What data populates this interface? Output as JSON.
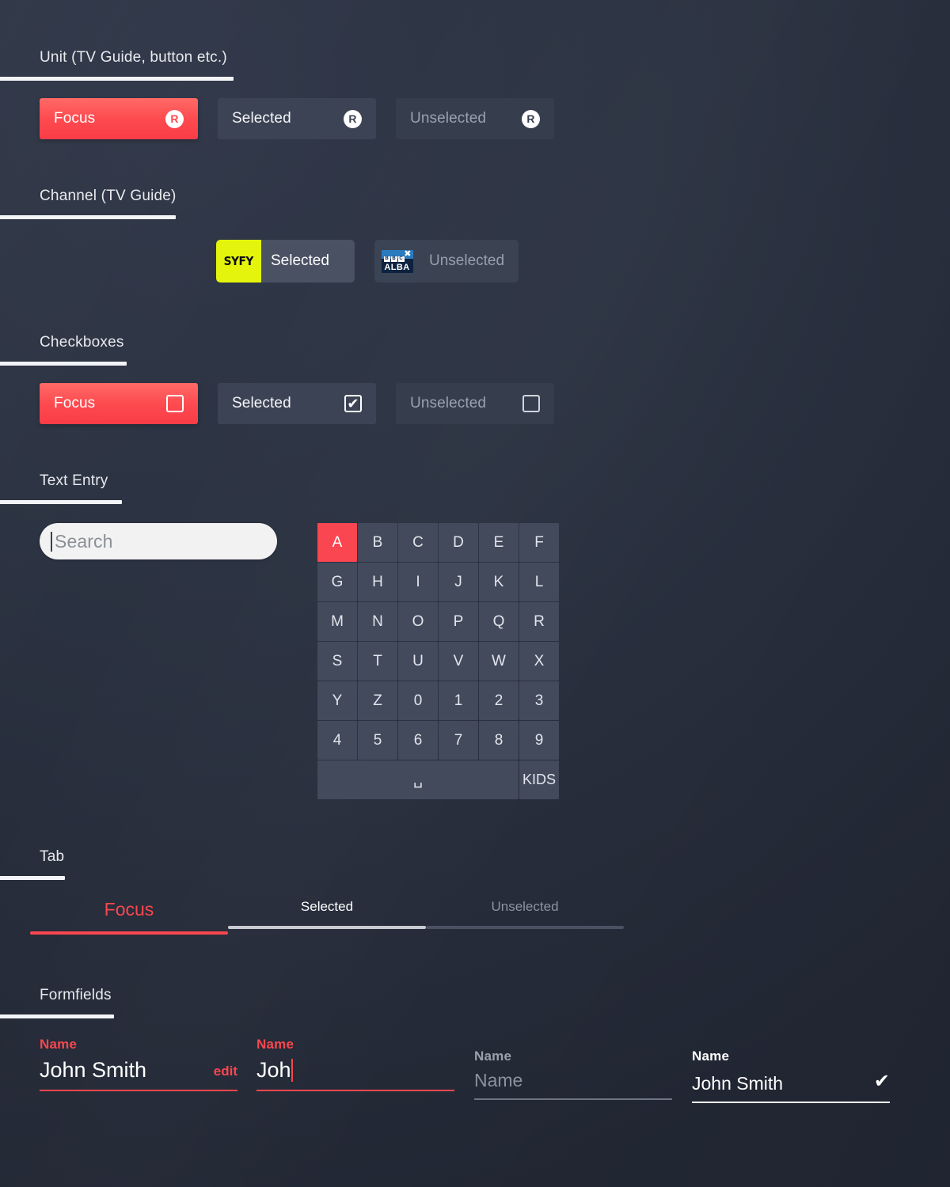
{
  "sections": [
    {
      "title": "Unit (TV Guide, button etc.)",
      "rule_width": 295
    },
    {
      "title": "Channel (TV Guide)",
      "rule_width": 222
    },
    {
      "title": "Checkboxes",
      "rule_width": 160
    },
    {
      "title": "Text Entry",
      "rule_width": 154
    },
    {
      "title": "Tab",
      "rule_width": 82
    },
    {
      "title": "Formfields",
      "rule_width": 144
    }
  ],
  "unit": {
    "items": [
      {
        "label": "Focus",
        "state": "focus",
        "icon": "remote-control-icon",
        "icon_glyph": "R"
      },
      {
        "label": "Selected",
        "state": "selected",
        "icon": "remote-control-icon",
        "icon_glyph": "R"
      },
      {
        "label": "Unselected",
        "state": "unselected",
        "icon": "remote-control-icon",
        "icon_glyph": "R"
      }
    ]
  },
  "channel": {
    "items": [
      {
        "label": "Selected",
        "state": "selected",
        "logo": "syfy-logo",
        "logo_text": "SYFY"
      },
      {
        "label": "Unselected",
        "state": "unselected",
        "logo": "bbc-alba-logo",
        "logo_text": "ALBA",
        "logo_sub": "BBC"
      }
    ]
  },
  "checkboxes": {
    "items": [
      {
        "label": "Focus",
        "state": "focus",
        "checked": false
      },
      {
        "label": "Selected",
        "state": "selected",
        "checked": true
      },
      {
        "label": "Unselected",
        "state": "unselected",
        "checked": false
      }
    ],
    "tick_glyph": "✔"
  },
  "text_entry": {
    "search_placeholder": "Search",
    "keyboard_keys": [
      "A",
      "B",
      "C",
      "D",
      "E",
      "F",
      "G",
      "H",
      "I",
      "J",
      "K",
      "L",
      "M",
      "N",
      "O",
      "P",
      "Q",
      "R",
      "S",
      "T",
      "U",
      "V",
      "W",
      "X",
      "Y",
      "Z",
      "0",
      "1",
      "2",
      "3",
      "4",
      "5",
      "6",
      "7",
      "8",
      "9"
    ],
    "focused_key": "A",
    "space_label": "␣",
    "kids_label": "KIDS"
  },
  "tabs": {
    "items": [
      {
        "label": "Focus",
        "state": "focus"
      },
      {
        "label": "Selected",
        "state": "selected"
      },
      {
        "label": "Unselected",
        "state": "unselected"
      }
    ]
  },
  "formfields": {
    "items": [
      {
        "label": "Name",
        "value": "John Smith",
        "action": "edit",
        "style": "red",
        "caret": false,
        "check": false
      },
      {
        "label": "Name",
        "value": "Joh",
        "action": "",
        "style": "red",
        "caret": true,
        "check": false
      },
      {
        "label": "Name",
        "value": "Name",
        "action": "",
        "style": "muted",
        "caret": false,
        "check": false
      },
      {
        "label": "Name",
        "value": "John Smith",
        "action": "",
        "style": "white",
        "caret": false,
        "check": true,
        "check_glyph": "✔"
      }
    ]
  },
  "colors": {
    "background": "#2a3040",
    "accent_red": "#f9474f",
    "focus_red_top": "#ff6a67",
    "chip_selected": "#3c4354",
    "chip_unselected": "#363d4d",
    "key_bg": "#434a5c",
    "syfy_yellow": "#e4f40c",
    "alba_blue": "#2b7bbf",
    "alba_navy": "#0d2240",
    "search_bg": "#f2f2f2"
  }
}
